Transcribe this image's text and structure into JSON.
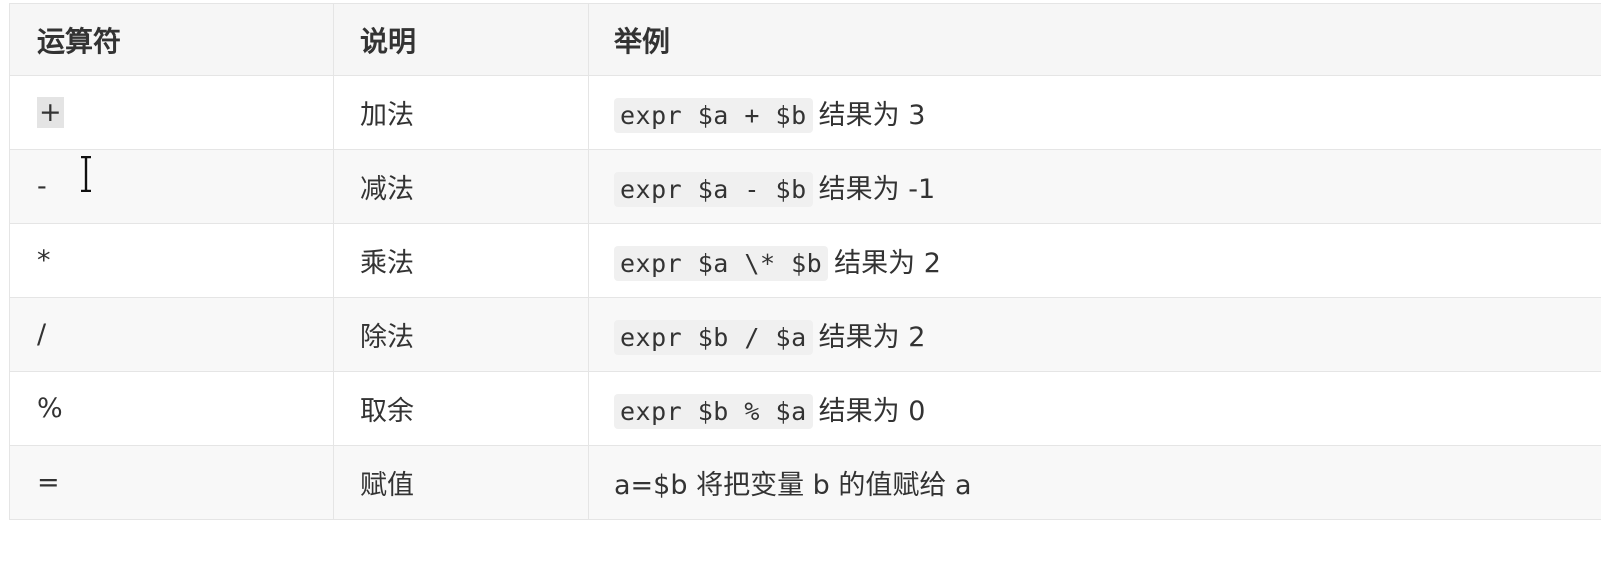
{
  "table": {
    "headers": [
      "运算符",
      "说明",
      "举例"
    ],
    "rows": [
      {
        "op": "+",
        "desc": "加法",
        "code": "expr $a + $b",
        "result": "结果为 3"
      },
      {
        "op": "-",
        "desc": "减法",
        "code": "expr $a - $b",
        "result": "结果为 -1"
      },
      {
        "op": "*",
        "desc": "乘法",
        "code": "expr $a \\* $b",
        "result": "结果为  2"
      },
      {
        "op": "/",
        "desc": "除法",
        "code": "expr $b / $a",
        "result": "结果为 2"
      },
      {
        "op": "%",
        "desc": "取余",
        "code": "expr $b % $a",
        "result": "结果为 0"
      },
      {
        "op": "=",
        "desc": "赋值",
        "code": "",
        "result": "a=$b 将把变量 b 的值赋给 a"
      }
    ]
  },
  "cursor": {
    "type": "text-ibeam-cursor"
  },
  "colors": {
    "header_bg": "#f6f6f6",
    "even_row_bg": "#f8f8f8",
    "code_bg": "#f0f0f0",
    "border": "#e5e5e5",
    "text": "#333333"
  }
}
